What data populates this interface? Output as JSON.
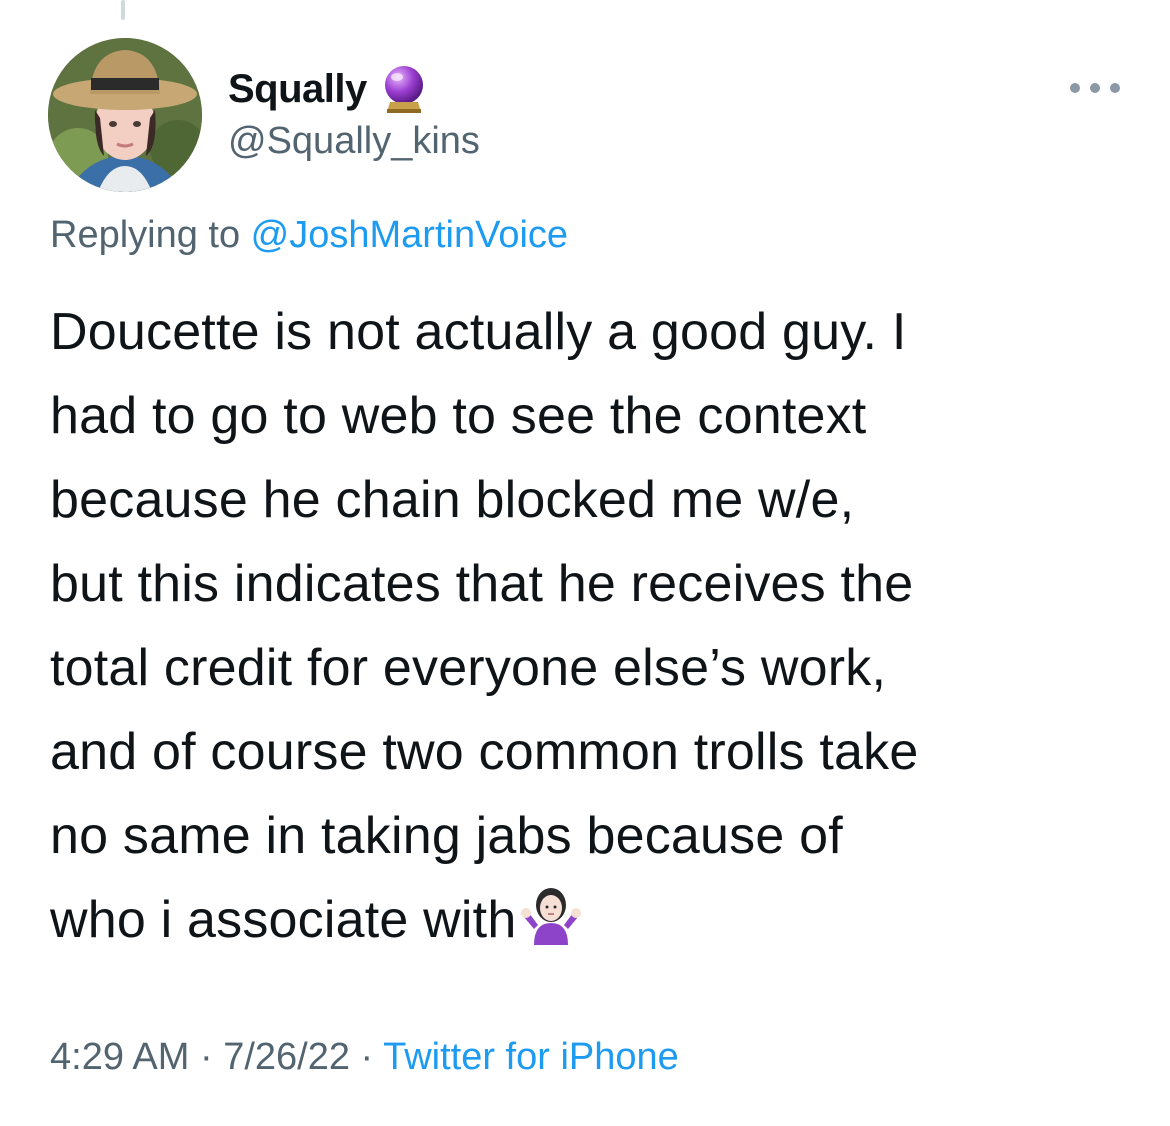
{
  "author": {
    "display_name": "Squally",
    "handle": "@Squally_kins",
    "badge_icon": "crystal-ball-icon",
    "avatar_icon": "profile-photo"
  },
  "reply": {
    "prefix": "Replying to ",
    "mention": "@JoshMartinVoice"
  },
  "tweet": {
    "text": "Doucette is not actually a good guy. I\nhad to go to web to see the context\nbecause he chain blocked me w/e,\nbut this indicates that he receives the\ntotal credit for everyone else’s work,\nand of course two common trolls take\nno same in taking jabs because of\nwho i associate with",
    "trailing_emoji_icon": "person-shrugging-icon"
  },
  "meta": {
    "time": "4:29 AM",
    "date": "7/26/22",
    "separator": " · ",
    "source": "Twitter for iPhone"
  },
  "colors": {
    "text": "#0f1419",
    "secondary": "#536471",
    "link": "#1d9bf0"
  }
}
